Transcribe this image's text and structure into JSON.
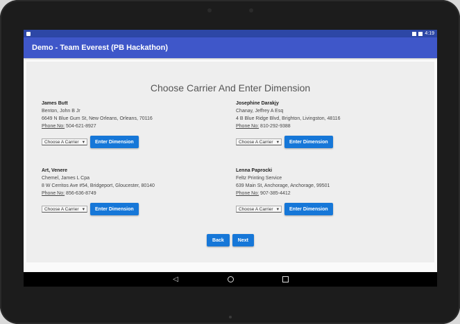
{
  "status": {
    "time": "4:19"
  },
  "appbar": {
    "title": "Demo - Team Everest (PB Hackathon)"
  },
  "page": {
    "title": "Choose Carrier And Enter Dimension"
  },
  "phone_label": "Phone No:",
  "carrier_select_label": "Choose A Carrier",
  "enter_dimension_label": "Enter Dimension",
  "cards": [
    {
      "name": "James Butt",
      "contact": "Benton, John B Jr",
      "address": "6649 N Blue Gum St, New Orleans, Orleans, 70116",
      "phone": "504-621-8927"
    },
    {
      "name": "Josephine Darakjy",
      "contact": "Chanay, Jeffrey A Esq",
      "address": "4 B Blue Ridge Blvd, Brighton, Livingston, 48116",
      "phone": "810-292-9388"
    },
    {
      "name": "Art, Venere",
      "contact": "Chemel, James L Cpa",
      "address": "8 W Cerritos Ave #54, Bridgeport, Gloucester, 80140",
      "phone": "856-636-8749"
    },
    {
      "name": "Lenna Paprocki",
      "contact": "Feltz Printing Service",
      "address": "639 Main St, Anchorage, Anchorage, 99501",
      "phone": "907-385-4412"
    }
  ],
  "nav": {
    "back_label": "Back",
    "next_label": "Next"
  },
  "icons": {
    "back": "back-triangle-icon",
    "home": "home-circle-icon",
    "recents": "recents-square-icon"
  },
  "colors": {
    "statusbar": "#2d47a6",
    "appbar": "#3f57c9",
    "button": "#1677d8"
  }
}
